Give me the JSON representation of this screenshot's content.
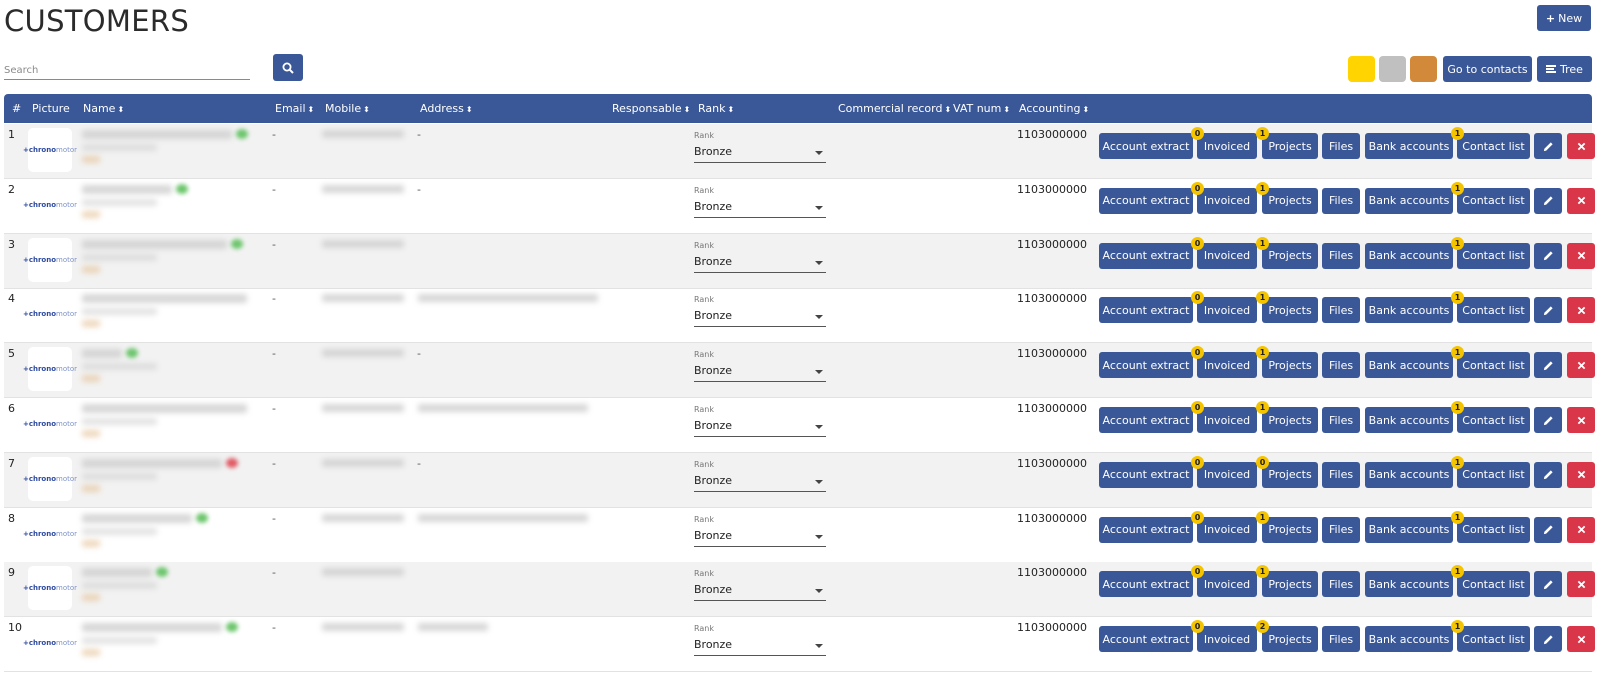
{
  "page": {
    "title": "CUSTOMERS"
  },
  "toolbar": {
    "new_label": "New",
    "search_placeholder": "Search",
    "search_value": "",
    "swatches": [
      {
        "name": "gold",
        "color": "#FFD400"
      },
      {
        "name": "silver",
        "color": "#C0C0C0"
      },
      {
        "name": "bronze",
        "color": "#D28A3A"
      }
    ],
    "go_to_contacts_label": "Go to contacts",
    "tree_label": "Tree"
  },
  "table": {
    "headers": {
      "num": "#",
      "picture": "Picture",
      "name": "Name",
      "email": "Email",
      "mobile": "Mobile",
      "address": "Address",
      "responsable": "Responsable",
      "rank": "Rank",
      "commercial_record": "Commercial record",
      "vat_num": "VAT num",
      "accounting": "Accounting"
    },
    "rank_label": "Rank",
    "logo_text": {
      "brand": "+chrono",
      "suffix": "motor"
    },
    "actions": {
      "account_extract": "Account extract",
      "invoiced": "Invoiced",
      "projects": "Projects",
      "files": "Files",
      "bank_accounts": "Bank accounts",
      "contact_list": "Contact list"
    },
    "rows": [
      {
        "num": "1",
        "email": "-",
        "address": "-",
        "rank": "Bronze",
        "accounting": "1103000000",
        "invoiced_count": "0",
        "projects_count": "1",
        "contacts_count": "1",
        "status_color": "#6cc56c"
      },
      {
        "num": "2",
        "email": "-",
        "address": "-",
        "rank": "Bronze",
        "accounting": "1103000000",
        "invoiced_count": "0",
        "projects_count": "1",
        "contacts_count": "1",
        "status_color": "#6cc56c"
      },
      {
        "num": "3",
        "email": "-",
        "address": "",
        "rank": "Bronze",
        "accounting": "1103000000",
        "invoiced_count": "0",
        "projects_count": "1",
        "contacts_count": "1",
        "status_color": "#6cc56c"
      },
      {
        "num": "4",
        "email": "-",
        "address": "",
        "rank": "Bronze",
        "accounting": "1103000000",
        "invoiced_count": "0",
        "projects_count": "1",
        "contacts_count": "1",
        "status_color": ""
      },
      {
        "num": "5",
        "email": "-",
        "address": "-",
        "rank": "Bronze",
        "accounting": "1103000000",
        "invoiced_count": "0",
        "projects_count": "1",
        "contacts_count": "1",
        "status_color": "#6cc56c"
      },
      {
        "num": "6",
        "email": "-",
        "address": "",
        "rank": "Bronze",
        "accounting": "1103000000",
        "invoiced_count": "0",
        "projects_count": "1",
        "contacts_count": "1",
        "status_color": ""
      },
      {
        "num": "7",
        "email": "-",
        "address": "-",
        "rank": "Bronze",
        "accounting": "1103000000",
        "invoiced_count": "0",
        "projects_count": "0",
        "contacts_count": "1",
        "status_color": "#e05a64"
      },
      {
        "num": "8",
        "email": "-",
        "address": "",
        "rank": "Bronze",
        "accounting": "1103000000",
        "invoiced_count": "0",
        "projects_count": "1",
        "contacts_count": "1",
        "status_color": "#6cc56c"
      },
      {
        "num": "9",
        "email": "-",
        "address": "",
        "rank": "Bronze",
        "accounting": "1103000000",
        "invoiced_count": "0",
        "projects_count": "1",
        "contacts_count": "1",
        "status_color": "#6cc56c"
      },
      {
        "num": "10",
        "email": "-",
        "address": "",
        "rank": "Bronze",
        "accounting": "1103000000",
        "invoiced_count": "0",
        "projects_count": "2",
        "contacts_count": "1",
        "status_color": "#6cc56c"
      }
    ]
  }
}
